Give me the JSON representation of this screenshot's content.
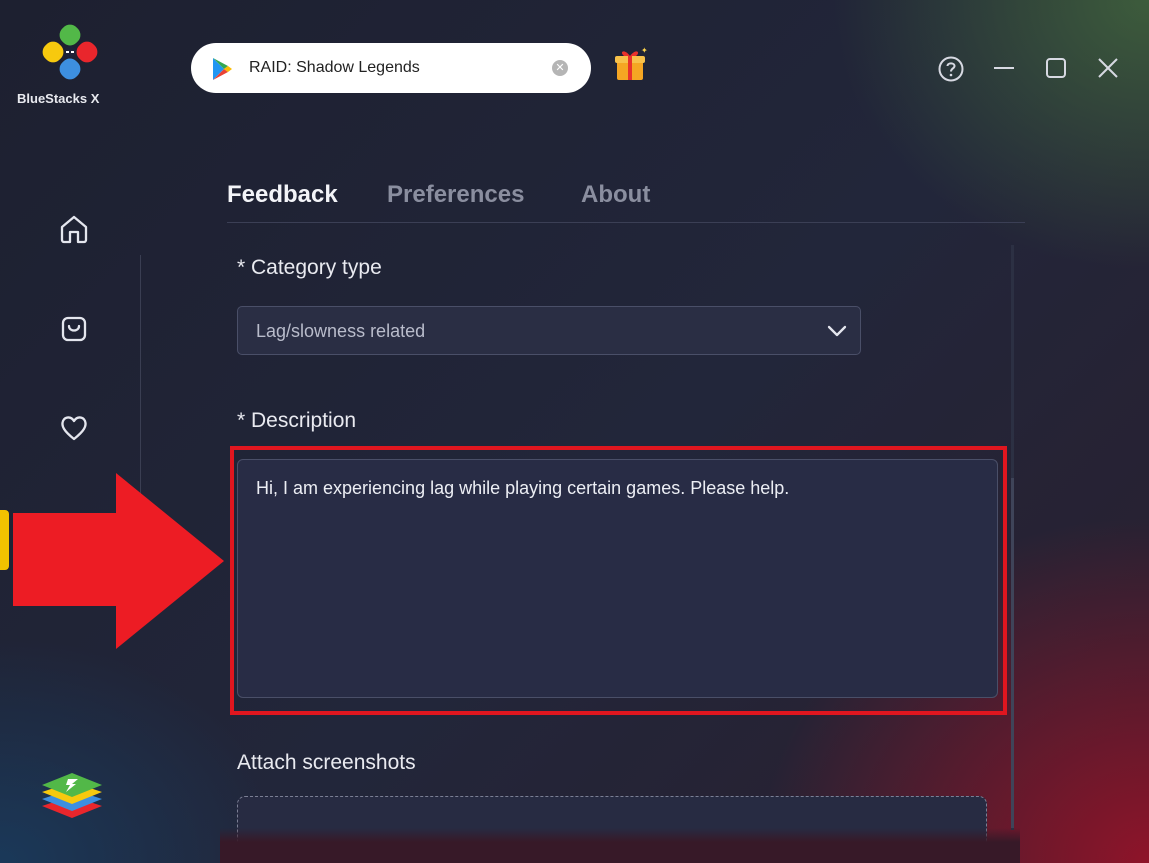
{
  "app": {
    "brand": "BlueStacks X"
  },
  "search": {
    "query": "RAID: Shadow Legends"
  },
  "icons": {
    "logo": "bluestacks-x-logo",
    "play_store": "google-play-icon",
    "clear": "clear-icon",
    "gift": "gift-icon",
    "help": "help-icon",
    "minimize": "minimize-icon",
    "maximize": "maximize-icon",
    "close": "close-icon",
    "home": "home-icon",
    "store": "shopping-bag-icon",
    "favorites": "heart-icon",
    "bluestacks": "bluestacks-icon",
    "dropdown": "chevron-down-icon"
  },
  "tabs": [
    {
      "label": "Feedback",
      "active": true
    },
    {
      "label": "Preferences",
      "active": false
    },
    {
      "label": "About",
      "active": false
    }
  ],
  "form": {
    "category_label": "* Category type",
    "category_value": "Lag/slowness related",
    "description_label": "* Description",
    "description_value": "Hi, I am experiencing lag while playing certain games. Please help.",
    "attach_label": "Attach screenshots"
  },
  "colors": {
    "accent": "#f2c200",
    "highlight": "#e0161f",
    "background": "#1f2230"
  }
}
